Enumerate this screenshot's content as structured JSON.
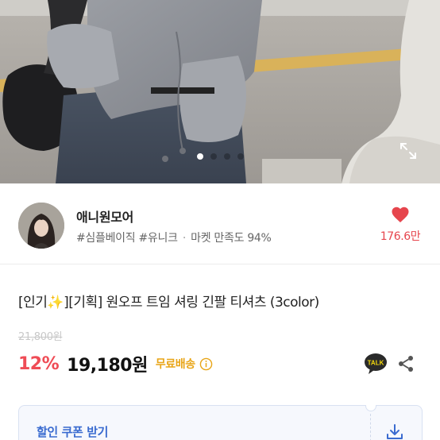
{
  "gallery": {
    "slides": [
      {
        "active": true
      },
      {
        "active": false
      },
      {
        "active": false
      },
      {
        "active": false
      }
    ],
    "expand_icon": "expand-icon"
  },
  "seller": {
    "name": "애니원모어",
    "tags": "#심플베이직 #유니크",
    "satisfaction": "마켓 만족도 94%",
    "likes": "176.6만",
    "like_icon": "heart-icon",
    "like_color": "#e6454d"
  },
  "product": {
    "title": "[인기✨][기획] 원오프 트임 셔링 긴팔 티셔츠 (3color)",
    "original_price": "21,800원",
    "discount": "12%",
    "price": "19,180원",
    "shipping": "무료배송",
    "talk_label": "TALK"
  },
  "coupon": {
    "label": "할인 쿠폰 받기",
    "download_icon": "download-icon"
  },
  "colors": {
    "discount": "#ef4c56",
    "shipping": "#e8a517",
    "coupon": "#3a6bd0"
  }
}
